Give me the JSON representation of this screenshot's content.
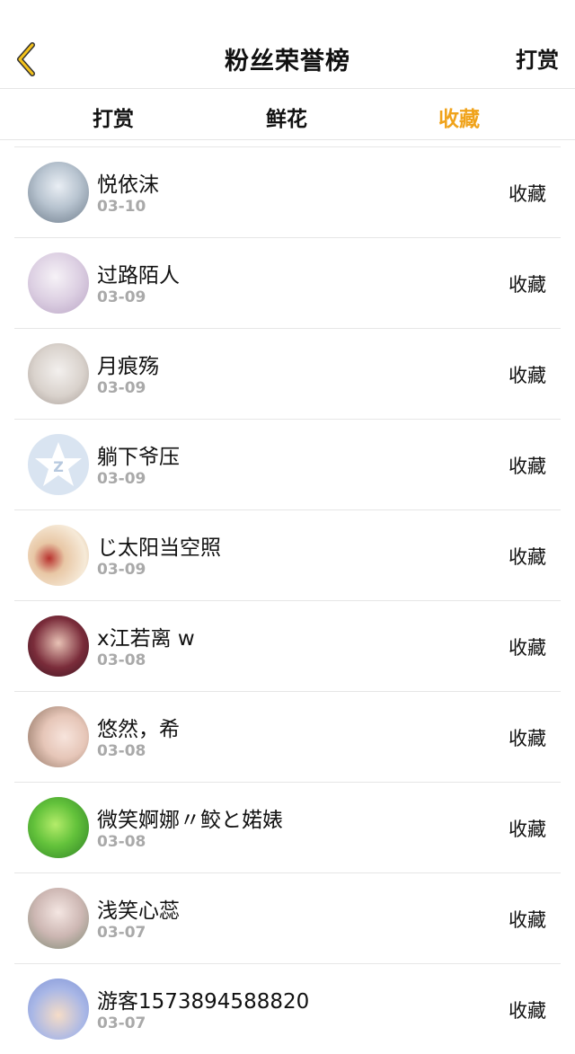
{
  "header": {
    "title": "粉丝荣誉榜",
    "action_label": "打赏",
    "back_icon": "chevron-left-icon"
  },
  "tabs": [
    {
      "label": "打赏",
      "active": false
    },
    {
      "label": "鲜花",
      "active": false
    },
    {
      "label": "收藏",
      "active": true
    }
  ],
  "colors": {
    "accent": "#f0a31b",
    "date": "#a9a9a9",
    "divider": "#e6e6e6"
  },
  "list": {
    "items": [
      {
        "name": "悦依沫",
        "date": "03-10",
        "action": "收藏"
      },
      {
        "name": "过路陌人",
        "date": "03-09",
        "action": "收藏"
      },
      {
        "name": "月痕殇",
        "date": "03-09",
        "action": "收藏"
      },
      {
        "name": "躺下爷压",
        "date": "03-09",
        "action": "收藏"
      },
      {
        "name": "じ太阳当空照",
        "date": "03-09",
        "action": "收藏"
      },
      {
        "name": "x江若离 w",
        "date": "03-08",
        "action": "收藏"
      },
      {
        "name": "悠然，希",
        "date": "03-08",
        "action": "收藏"
      },
      {
        "name": "微笑婀娜〃鲛と婼婊",
        "date": "03-08",
        "action": "收藏"
      },
      {
        "name": "浅笑心蕊",
        "date": "03-07",
        "action": "收藏"
      },
      {
        "name": "游客1573894588820",
        "date": "03-07",
        "action": "收藏"
      }
    ]
  }
}
